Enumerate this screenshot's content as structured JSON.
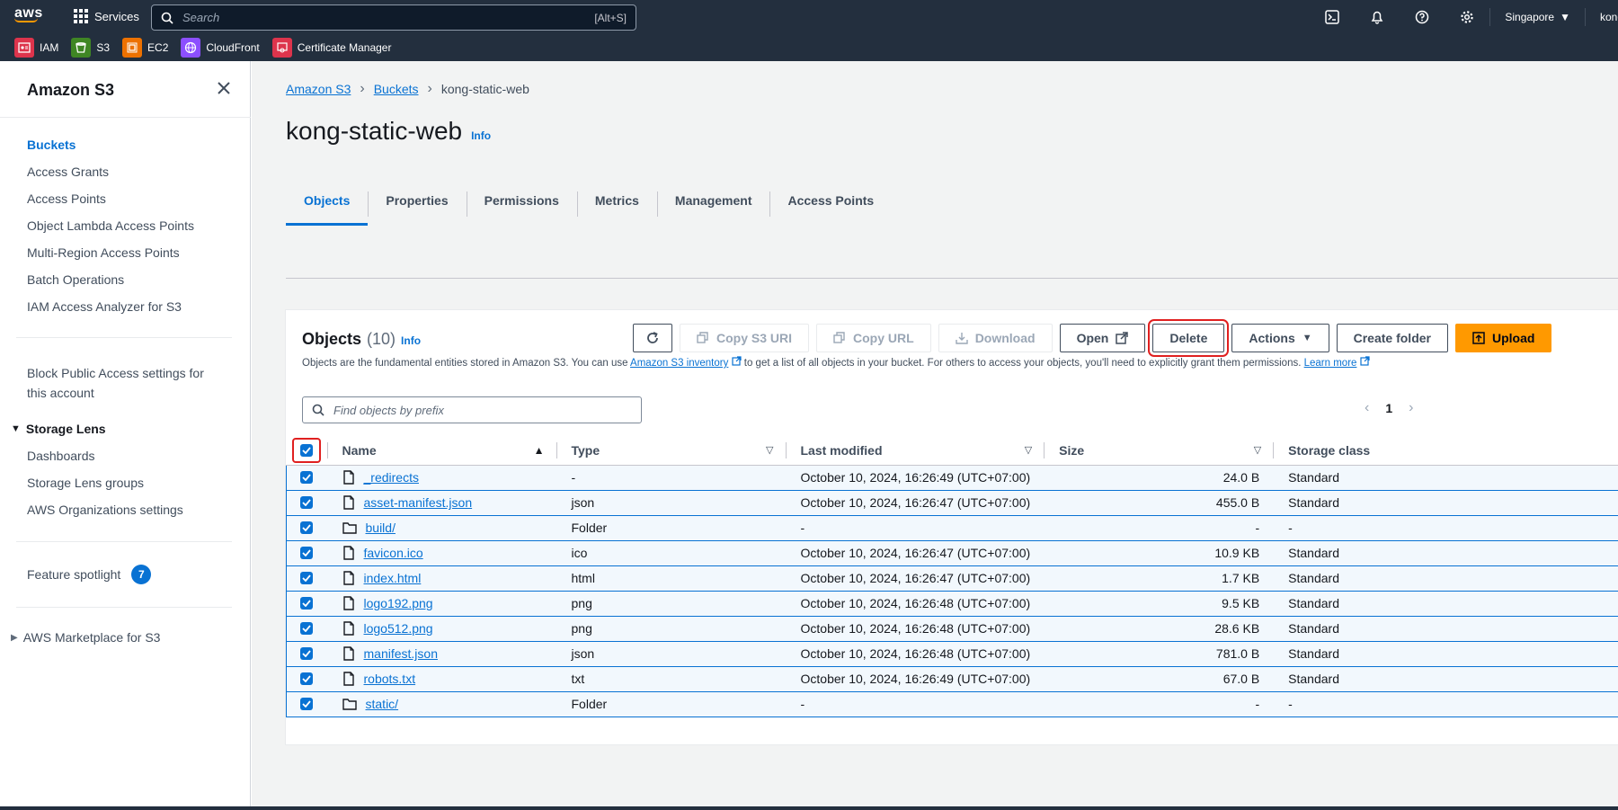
{
  "topnav": {
    "logo": "aws",
    "services_label": "Services",
    "search_placeholder": "Search",
    "search_shortcut": "[Alt+S]",
    "region": "Singapore",
    "account": "kongt",
    "favorites": [
      {
        "label": "IAM",
        "color": "#dd344c"
      },
      {
        "label": "S3",
        "color": "#3f8624"
      },
      {
        "label": "EC2",
        "color": "#ed7100"
      },
      {
        "label": "CloudFront",
        "color": "#8c4fff"
      },
      {
        "label": "Certificate Manager",
        "color": "#dd344c"
      }
    ]
  },
  "sidebar": {
    "title": "Amazon S3",
    "items": [
      "Buckets",
      "Access Grants",
      "Access Points",
      "Object Lambda Access Points",
      "Multi-Region Access Points",
      "Batch Operations",
      "IAM Access Analyzer for S3"
    ],
    "block_public_line1": "Block Public Access settings for",
    "block_public_line2": "this account",
    "storage_lens": "Storage Lens",
    "storage_lens_items": [
      "Dashboards",
      "Storage Lens groups",
      "AWS Organizations settings"
    ],
    "feature_spotlight": "Feature spotlight",
    "feature_spotlight_count": "7",
    "marketplace": "AWS Marketplace for S3"
  },
  "breadcrumb": [
    "Amazon S3",
    "Buckets",
    "kong-static-web"
  ],
  "page_title": "kong-static-web",
  "info_label": "Info",
  "tabs": [
    "Objects",
    "Properties",
    "Permissions",
    "Metrics",
    "Management",
    "Access Points"
  ],
  "objects": {
    "heading": "Objects",
    "count": "(10)",
    "info": "Info",
    "desc_before": "Objects are the fundamental entities stored in Amazon S3. You can use ",
    "desc_link1": "Amazon S3 inventory",
    "desc_middle": " to get a list of all objects in your bucket. For others to access your objects, you'll need to explicitly grant them permissions. ",
    "desc_link2": "Learn more",
    "buttons": {
      "copy_uri": "Copy S3 URI",
      "copy_url": "Copy URL",
      "download": "Download",
      "open": "Open",
      "delete": "Delete",
      "actions": "Actions",
      "create_folder": "Create folder",
      "upload": "Upload"
    },
    "find_placeholder": "Find objects by prefix",
    "page": "1",
    "columns": [
      "Name",
      "Type",
      "Last modified",
      "Size",
      "Storage class"
    ],
    "rows": [
      {
        "name": "_redirects",
        "type": "-",
        "modified": "October 10, 2024, 16:26:49 (UTC+07:00)",
        "size": "24.0 B",
        "class": "Standard",
        "kind": "file"
      },
      {
        "name": "asset-manifest.json",
        "type": "json",
        "modified": "October 10, 2024, 16:26:47 (UTC+07:00)",
        "size": "455.0 B",
        "class": "Standard",
        "kind": "file"
      },
      {
        "name": "build/",
        "type": "Folder",
        "modified": "-",
        "size": "-",
        "class": "-",
        "kind": "folder"
      },
      {
        "name": "favicon.ico",
        "type": "ico",
        "modified": "October 10, 2024, 16:26:47 (UTC+07:00)",
        "size": "10.9 KB",
        "class": "Standard",
        "kind": "file"
      },
      {
        "name": "index.html",
        "type": "html",
        "modified": "October 10, 2024, 16:26:47 (UTC+07:00)",
        "size": "1.7 KB",
        "class": "Standard",
        "kind": "file"
      },
      {
        "name": "logo192.png",
        "type": "png",
        "modified": "October 10, 2024, 16:26:48 (UTC+07:00)",
        "size": "9.5 KB",
        "class": "Standard",
        "kind": "file"
      },
      {
        "name": "logo512.png",
        "type": "png",
        "modified": "October 10, 2024, 16:26:48 (UTC+07:00)",
        "size": "28.6 KB",
        "class": "Standard",
        "kind": "file"
      },
      {
        "name": "manifest.json",
        "type": "json",
        "modified": "October 10, 2024, 16:26:48 (UTC+07:00)",
        "size": "781.0 B",
        "class": "Standard",
        "kind": "file"
      },
      {
        "name": "robots.txt",
        "type": "txt",
        "modified": "October 10, 2024, 16:26:49 (UTC+07:00)",
        "size": "67.0 B",
        "class": "Standard",
        "kind": "file"
      },
      {
        "name": "static/",
        "type": "Folder",
        "modified": "-",
        "size": "-",
        "class": "-",
        "kind": "folder"
      }
    ]
  },
  "colors": {
    "nav_bg": "#232f3e",
    "link": "#0972d3",
    "primary": "#ff9900",
    "highlight": "#e02020"
  }
}
